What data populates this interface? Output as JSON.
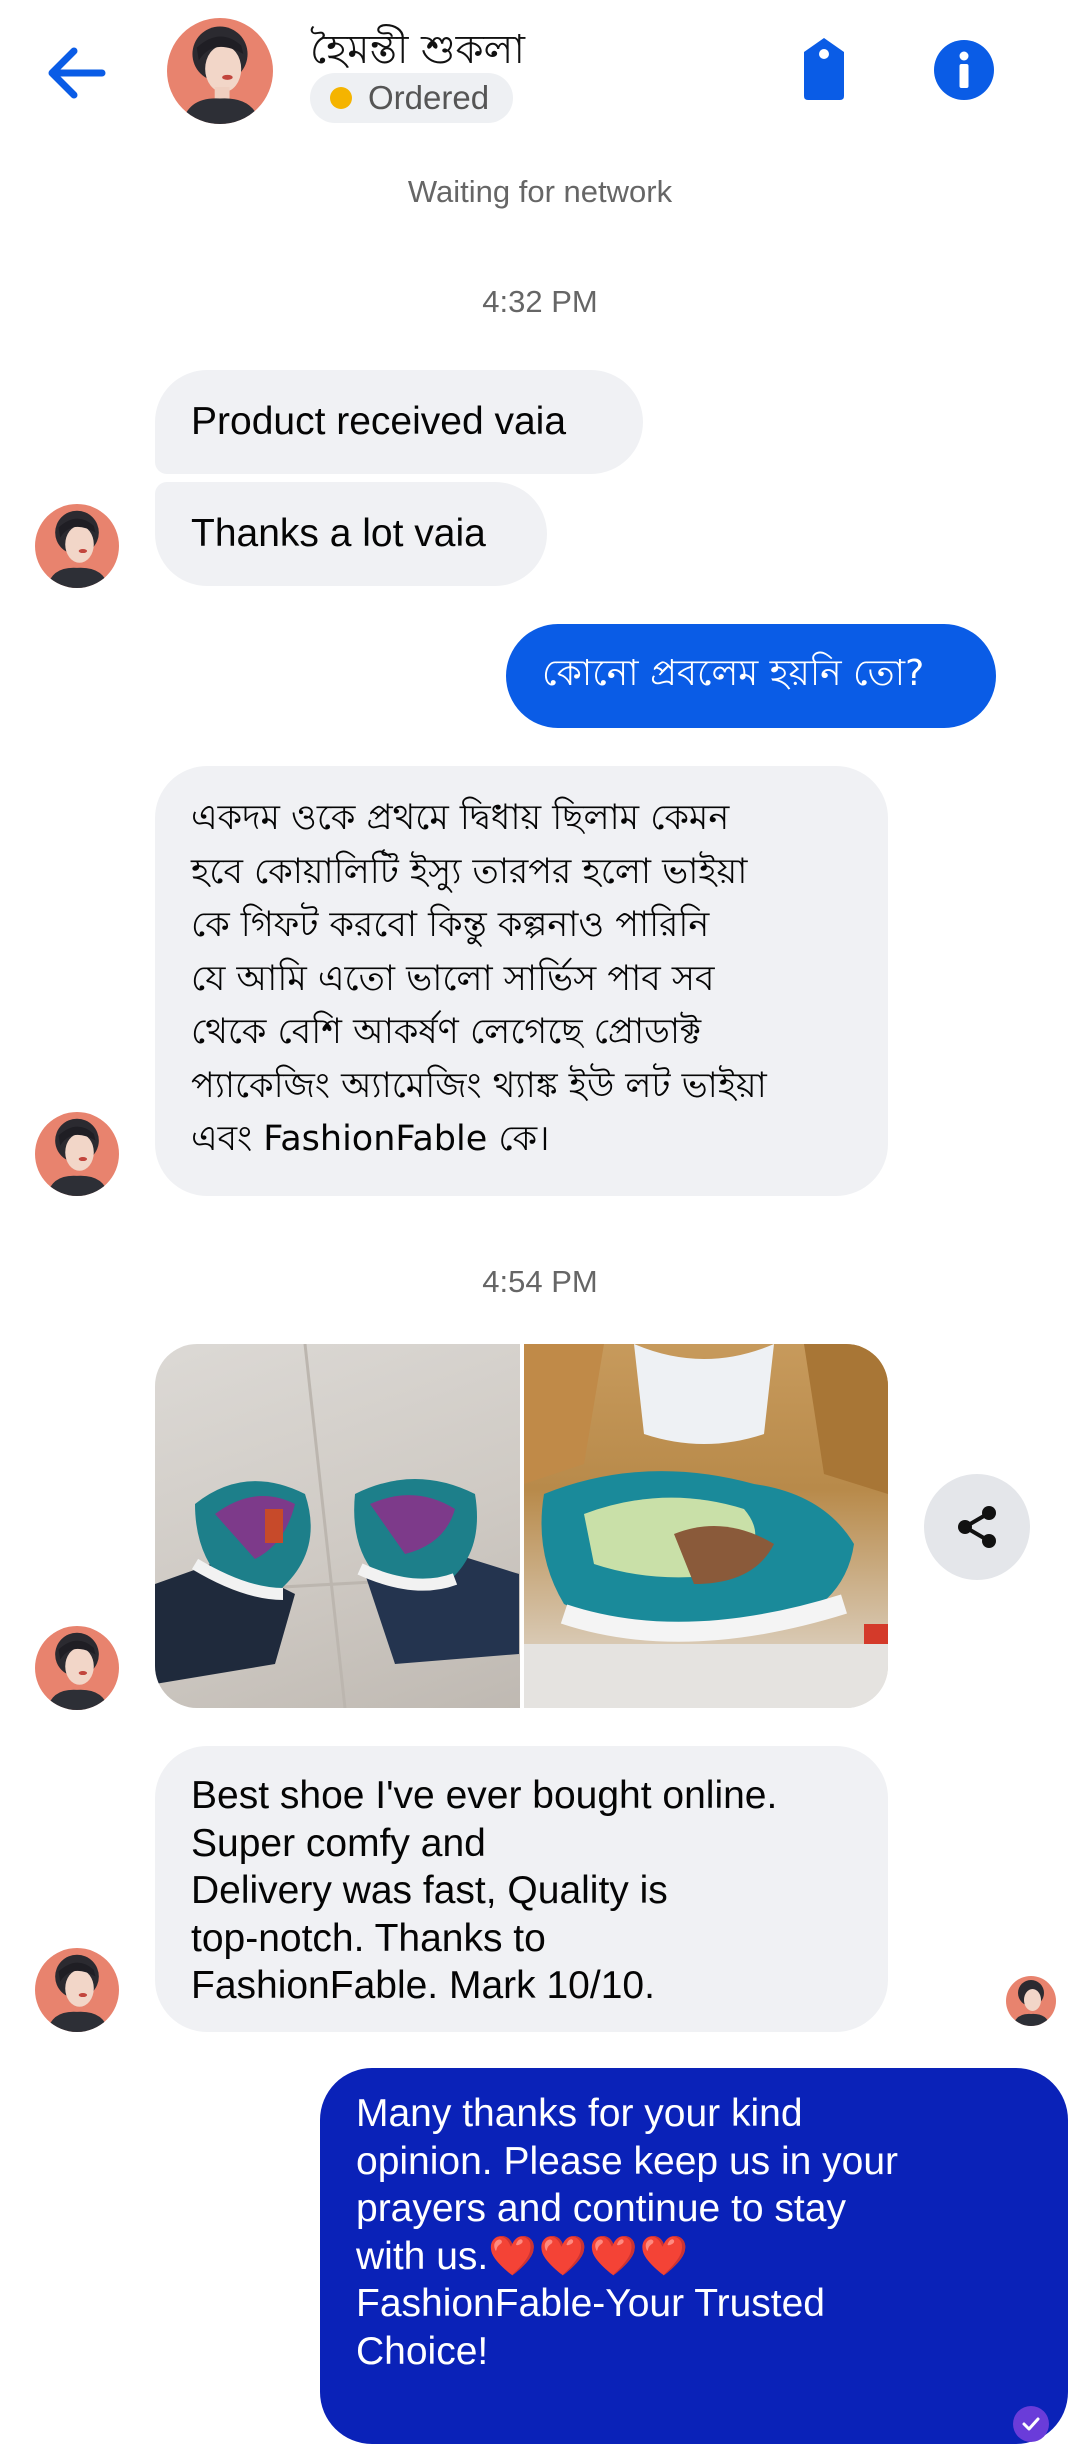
{
  "header": {
    "contact_name": "হৈমন্তী শুকলা",
    "status_label": "Ordered",
    "status_color": "#f5b400",
    "icons": [
      "back-arrow-icon",
      "tag-icon",
      "info-icon"
    ],
    "accent_color": "#0a5ce6"
  },
  "network_status": "Waiting for network",
  "timestamps": [
    "4:32 PM",
    "4:54 PM"
  ],
  "messages": {
    "m1": "Product received vaia",
    "m2": "Thanks a lot vaia",
    "m3": "কোনো প্রবলেম হয়নি তো?",
    "m4_lines": [
      "একদম ওকে প্রথমে দ্বিধায় ছিলাম কেমন",
      "হবে কোয়ালিটি ইস্যু তারপর হলো ভাইয়া",
      "কে গিফট করবো কিন্তু কল্পনাও  পারিনি",
      "যে আমি এতো ভালো সার্ভিস পাব সব",
      "থেকে বেশি আকর্ষণ লেগেছে প্রোডাক্ট",
      "প্যাকেজিং অ্যামেজিং থ্যাঙ্ক ইউ লট ভাইয়া",
      "এবং FashionFable কে।"
    ],
    "m5_lines": [
      "Best shoe I've ever bought online.",
      "Super comfy and",
      "Delivery was fast, Quality is",
      "top-notch. Thanks to",
      "FashionFable. Mark 10/10."
    ],
    "m6_lines": [
      "Many thanks for your kind",
      "opinion. Please keep us in your",
      "prayers and continue to stay",
      "with us.",
      "FashionFable-Your Trusted",
      "Choice!"
    ],
    "m6_hearts": "❤️❤️❤️❤️"
  },
  "attachments": [
    "shoes-worn-photo",
    "shoes-in-box-photo"
  ]
}
